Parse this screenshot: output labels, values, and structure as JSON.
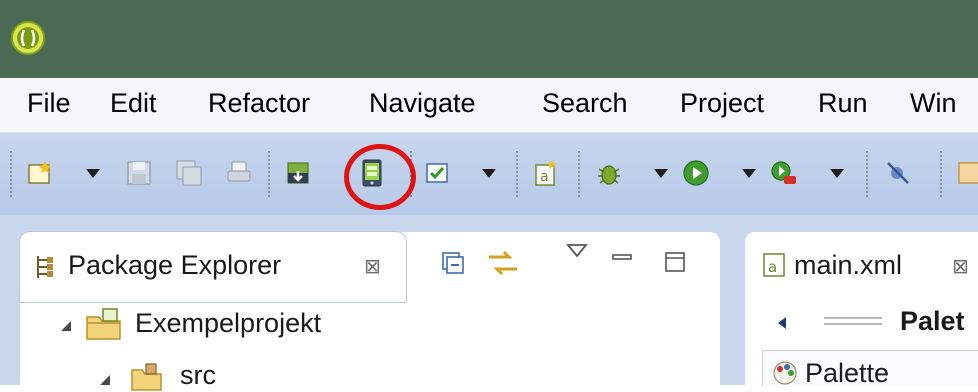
{
  "menu": {
    "file": "File",
    "edit": "Edit",
    "refactor": "Refactor",
    "navigate": "Navigate",
    "search": "Search",
    "project": "Project",
    "run": "Run",
    "window": "Win"
  },
  "toolbar": {
    "icons": [
      "new-wizard-icon",
      "save-icon",
      "save-all-icon",
      "print-icon",
      "sdk-manager-icon",
      "avd-manager-icon",
      "check-icon",
      "android-xml-icon",
      "debug-icon",
      "run-icon",
      "external-tools-icon",
      "skip-breakpoints-icon"
    ],
    "highlighted_icon": "avd-manager-icon",
    "highlight_color": "#e01313"
  },
  "package_explorer": {
    "tab_label": "Package Explorer",
    "close_glyph": "⊠",
    "tree": [
      {
        "label": "Exempelprojekt"
      },
      {
        "label": "src"
      }
    ]
  },
  "editor": {
    "tab_label": "main.xml",
    "close_glyph": "⊠",
    "palette_header": "Palet",
    "palette_item": "Palette"
  },
  "colors": {
    "titlebar": "#4a6a54",
    "toolbar": "#c0d0ec",
    "workarea": "#c9d7ec"
  }
}
